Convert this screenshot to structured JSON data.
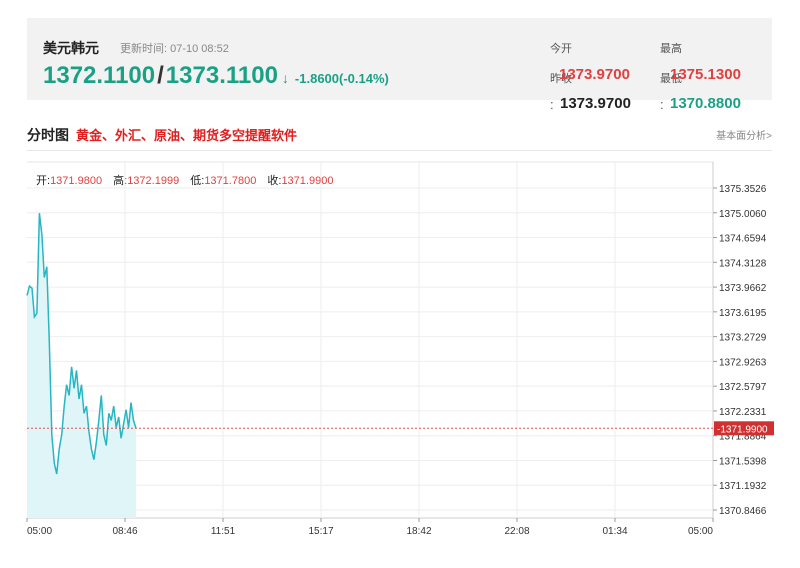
{
  "quote": {
    "name": "美元韩元",
    "update_label": "更新时间: 07-10 08:52",
    "bid": "1372.1100",
    "separator": "/",
    "ask": "1373.1100",
    "arrow": "↓",
    "change": "-1.8600(-0.14%)",
    "today_open_label": "今开",
    "today_open": "1373.9700",
    "prev_close_label": "昨收",
    "prev_close_value": "1373.9700",
    "high_label": "最高",
    "high": "1375.1300",
    "low_label": "最低",
    "low": "1370.8800",
    "colon": ":"
  },
  "section": {
    "title": "分时图",
    "promo": "黄金、外汇、原油、期货多空提醒软件",
    "basic_link": "基本面分析>"
  },
  "ohlc": {
    "open_label": "开:",
    "open": "1371.9800",
    "high_label": "高:",
    "high": "1372.1999",
    "low_label": "低:",
    "low": "1371.7800",
    "close_label": "收:",
    "close": "1371.9900"
  },
  "colors": {
    "up": "#e04040",
    "down": "#1aa185",
    "line": "#27b6c2",
    "fill": "#dff5f8",
    "ref_line": "#e05050"
  },
  "chart_data": {
    "type": "area",
    "y_ticks": [
      "1375.3526",
      "1375.0060",
      "1374.6594",
      "1374.3128",
      "1373.9662",
      "1373.6195",
      "1373.2729",
      "1372.9263",
      "1372.5797",
      "1372.2331",
      "1371.9900",
      "1371.8864",
      "1371.5398",
      "1371.1932",
      "1370.8466"
    ],
    "ylim": [
      1370.8466,
      1375.3526
    ],
    "x_ticks": [
      "05:00",
      "08:46",
      "11:51",
      "15:17",
      "18:42",
      "22:08",
      "01:34",
      "05:00"
    ],
    "reference_value": 1371.99,
    "reference_label": "1371.9900",
    "grid": true,
    "values": [
      1373.85,
      1373.98,
      1373.95,
      1373.55,
      1373.6,
      1375.0,
      1374.7,
      1374.1,
      1374.25,
      1373.2,
      1371.9,
      1371.5,
      1371.35,
      1371.7,
      1371.9,
      1372.3,
      1372.6,
      1372.45,
      1372.85,
      1372.55,
      1372.8,
      1372.4,
      1372.6,
      1372.2,
      1372.3,
      1371.95,
      1371.7,
      1371.55,
      1371.8,
      1372.1,
      1372.45,
      1371.9,
      1371.75,
      1372.2,
      1372.1,
      1372.3,
      1372.0,
      1372.15,
      1371.85,
      1372.05,
      1372.25,
      1372.0,
      1372.35,
      1372.1,
      1371.99
    ]
  }
}
